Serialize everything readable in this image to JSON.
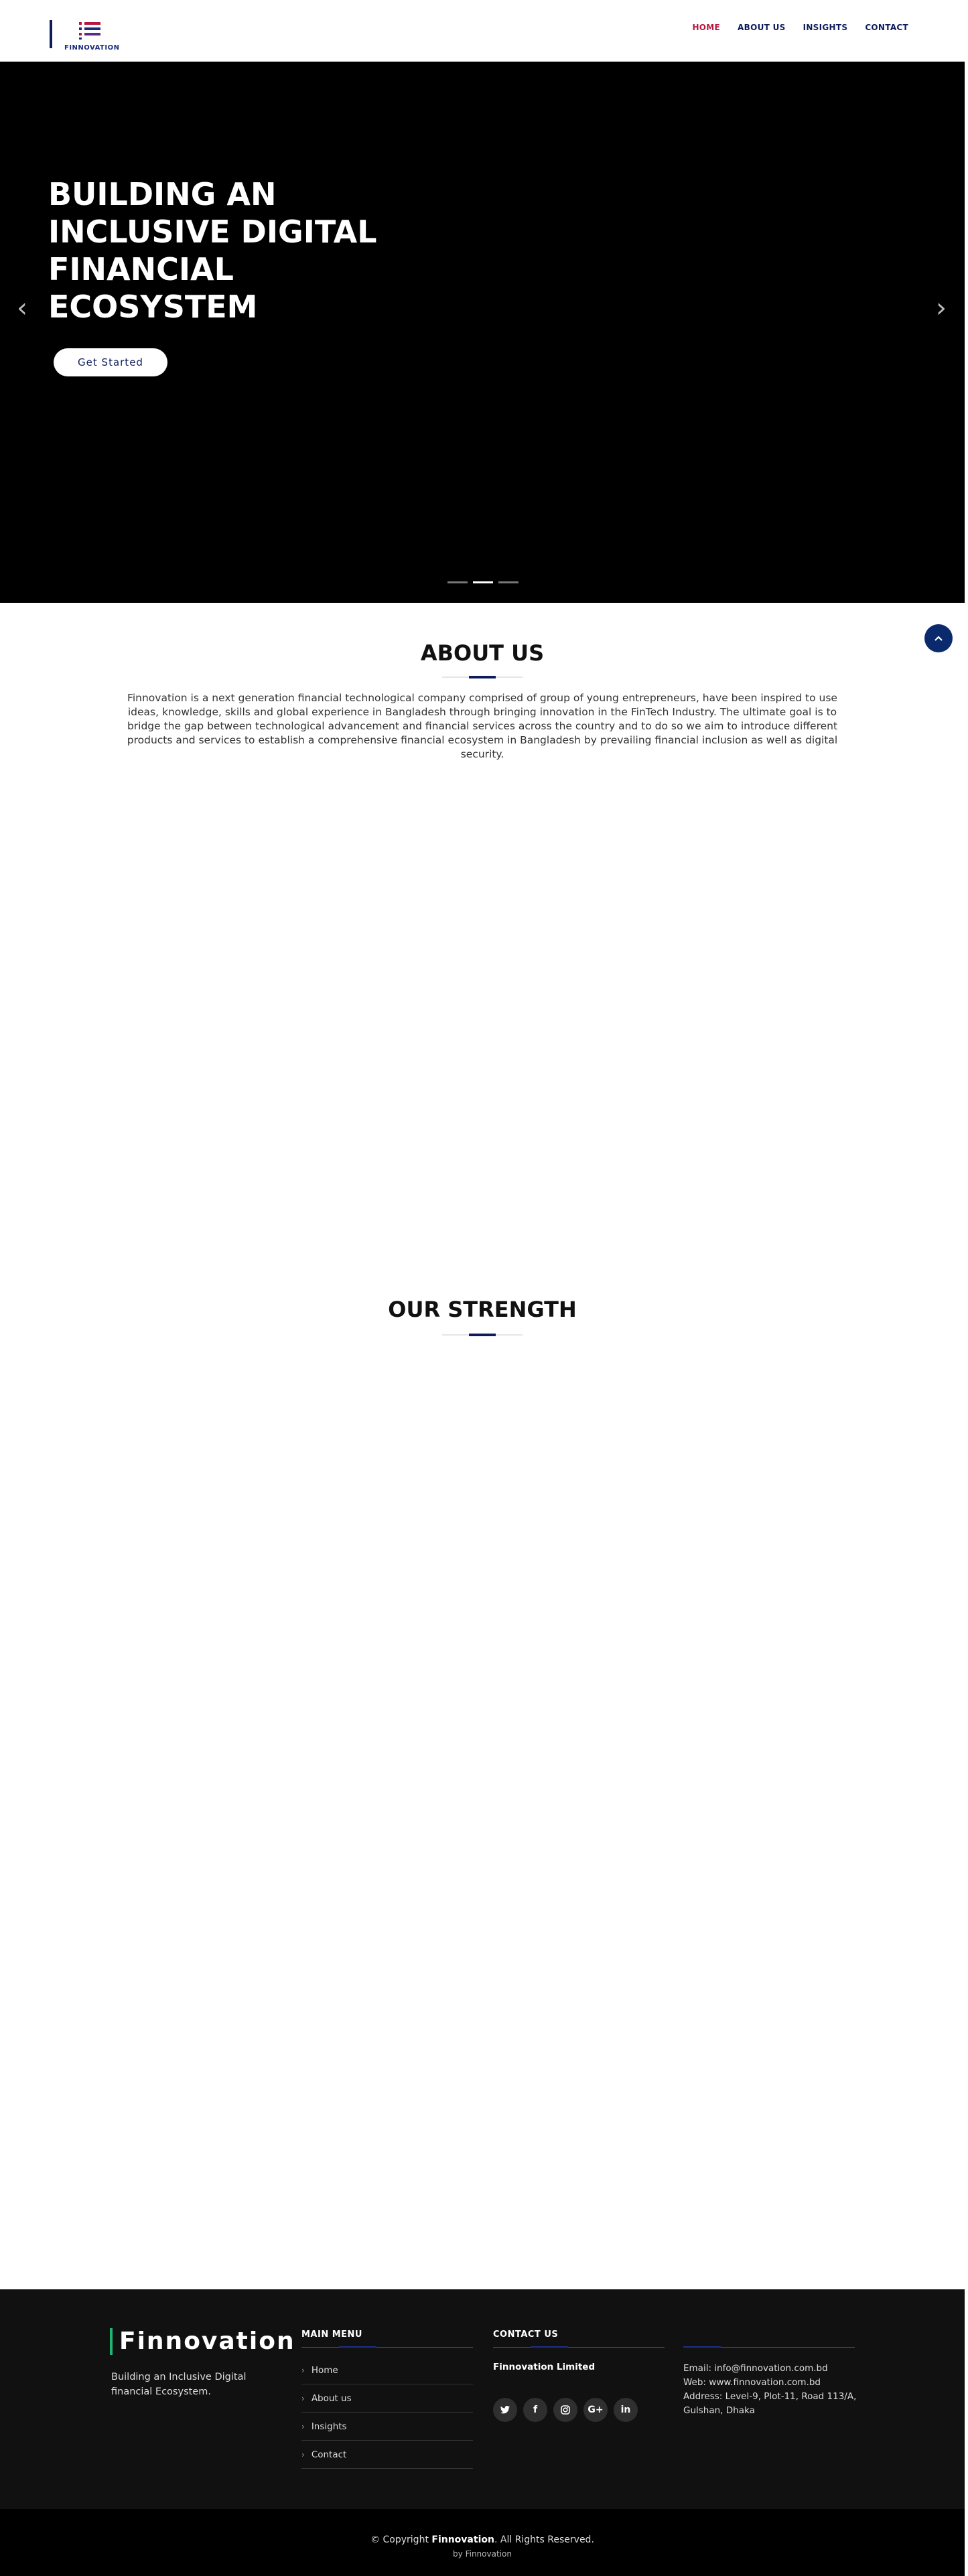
{
  "header": {
    "logo_text": "FINNOVATION",
    "nav": [
      {
        "label": "HOME",
        "active": true
      },
      {
        "label": "ABOUT US",
        "active": false
      },
      {
        "label": "INSIGHTS",
        "active": false
      },
      {
        "label": "CONTACT",
        "active": false
      }
    ],
    "colors": {
      "brand": "#0f1c5c",
      "active": "#b7173f"
    }
  },
  "hero": {
    "title": "BUILDING AN INCLUSIVE DIGITAL FINANCIAL ECOSYSTEM",
    "cta_label": "Get Started",
    "prev_icon": "chevron-left-icon",
    "next_icon": "chevron-right-icon",
    "slides": 3,
    "active_slide": 2,
    "scroll_top_icon": "chevron-up-icon"
  },
  "about": {
    "title": "ABOUT US",
    "body": "Finnovation is a next generation financial technological company comprised of group of young entrepreneurs, have been inspired to use ideas, knowledge, skills and global experience in Bangladesh through bringing innovation in the FinTech Industry. The ultimate goal is to bridge the gap between technological advancement and financial services across the country and to do so we aim to introduce different products and services to establish a comprehensive financial ecosystem in Bangladesh by prevailing financial inclusion as well as digital security."
  },
  "strength": {
    "title": "OUR STRENGTH"
  },
  "footer": {
    "brand": "Finnovation",
    "tagline": "Building an Inclusive Digital financial Ecosystem.",
    "menu_title": "MAIN MENU",
    "menu": [
      "Home",
      "About us",
      "Insights",
      "Contact"
    ],
    "contact_title": "CONTACT US",
    "company": "Finnovation Limited",
    "socials": [
      "twitter-icon",
      "facebook-icon",
      "instagram-icon",
      "google-plus-icon",
      "linkedin-icon"
    ],
    "email": "Email: info@finnovation.com.bd",
    "web": "Web: www.finnovation.com.bd",
    "address": "Address: Level-9, Plot-11, Road 113/A, Gulshan, Dhaka",
    "copyright_prefix": "© Copyright ",
    "copyright_brand": "Finnovation",
    "copyright_suffix": ". All Rights Reserved.",
    "by_line": "by Finnovation",
    "accent": "#21b573"
  }
}
